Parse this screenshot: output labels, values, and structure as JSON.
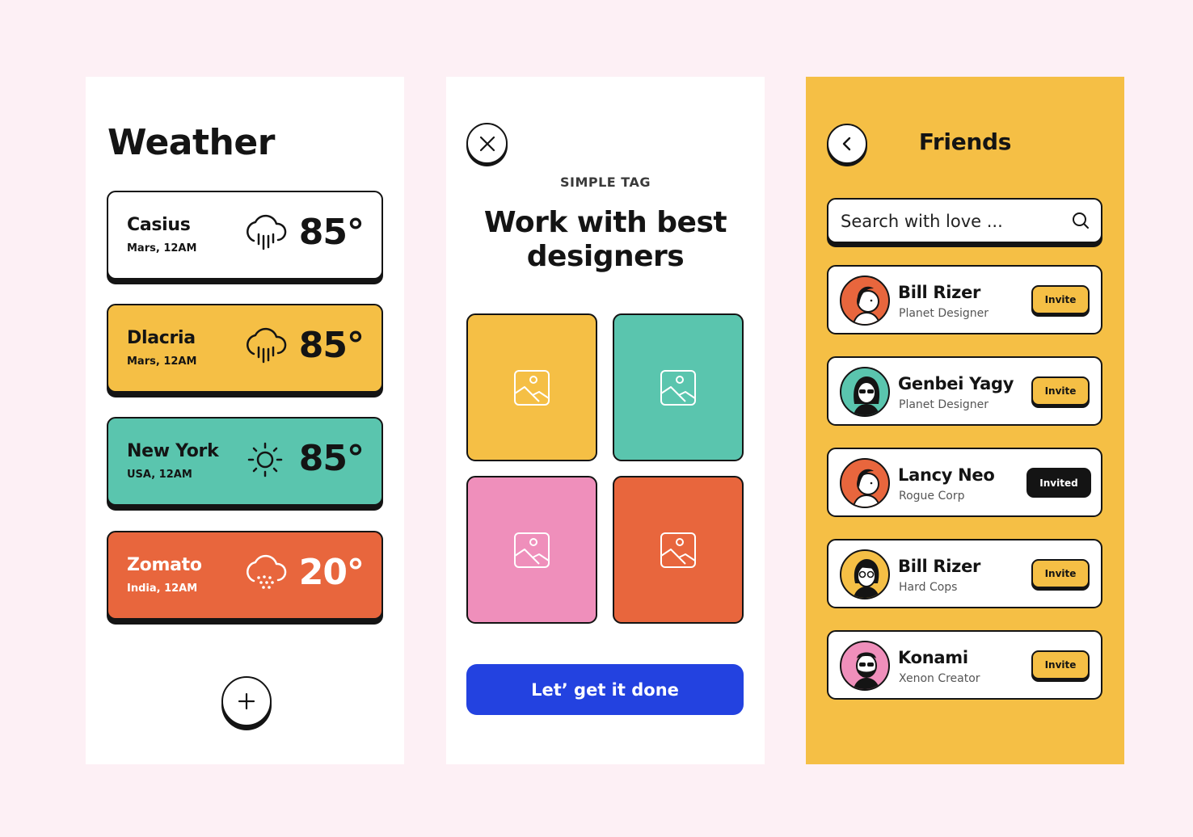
{
  "colors": {
    "background": "#fdf0f5",
    "yellow": "#f5bf45",
    "teal": "#5ac5ae",
    "orange": "#e8663d",
    "pink": "#ef8fbb",
    "blue": "#2342e0",
    "ink": "#141414"
  },
  "weather": {
    "title": "Weather",
    "cards": [
      {
        "city": "Casius",
        "sub": "Mars, 12AM",
        "temp": "85°",
        "icon": "rain-cloud-icon",
        "color": "#ffffff"
      },
      {
        "city": "Dlacria",
        "sub": "Mars, 12AM",
        "temp": "85°",
        "icon": "rain-cloud-icon",
        "color": "#f5bf45"
      },
      {
        "city": "New York",
        "sub": "USA, 12AM",
        "temp": "85°",
        "icon": "sun-icon",
        "color": "#5ac5ae"
      },
      {
        "city": "Zomato",
        "sub": "India, 12AM",
        "temp": "20°",
        "icon": "snow-cloud-icon",
        "color": "#e8663d"
      }
    ],
    "add_icon": "plus-icon"
  },
  "designers": {
    "close_icon": "close-icon",
    "tagline": "SIMPLE TAG",
    "headline_line1": "Work with best",
    "headline_line2": "designers",
    "tiles": [
      {
        "color": "#f5bf45",
        "icon": "image-placeholder-icon"
      },
      {
        "color": "#5ac5ae",
        "icon": "image-placeholder-icon"
      },
      {
        "color": "#ef8fbb",
        "icon": "image-placeholder-icon"
      },
      {
        "color": "#e8663d",
        "icon": "image-placeholder-icon"
      }
    ],
    "cta_label": "Let’ get it done"
  },
  "friends": {
    "back_icon": "chevron-left-icon",
    "title": "Friends",
    "search_placeholder": "Search with love ...",
    "search_icon": "search-icon",
    "list": [
      {
        "name": "Bill Rizer",
        "role": "Planet Designer",
        "action": "Invite",
        "state": "invite",
        "avatar_color": "#e8663d"
      },
      {
        "name": "Genbei Yagy",
        "role": "Planet Designer",
        "action": "Invite",
        "state": "invite",
        "avatar_color": "#5ac5ae"
      },
      {
        "name": "Lancy Neo",
        "role": "Rogue Corp",
        "action": "Invited",
        "state": "invited",
        "avatar_color": "#e8663d"
      },
      {
        "name": "Bill Rizer",
        "role": "Hard Cops",
        "action": "Invite",
        "state": "invite",
        "avatar_color": "#f5bf45"
      },
      {
        "name": "Konami",
        "role": "Xenon Creator",
        "action": "Invite",
        "state": "invite",
        "avatar_color": "#ef8fbb"
      }
    ]
  }
}
